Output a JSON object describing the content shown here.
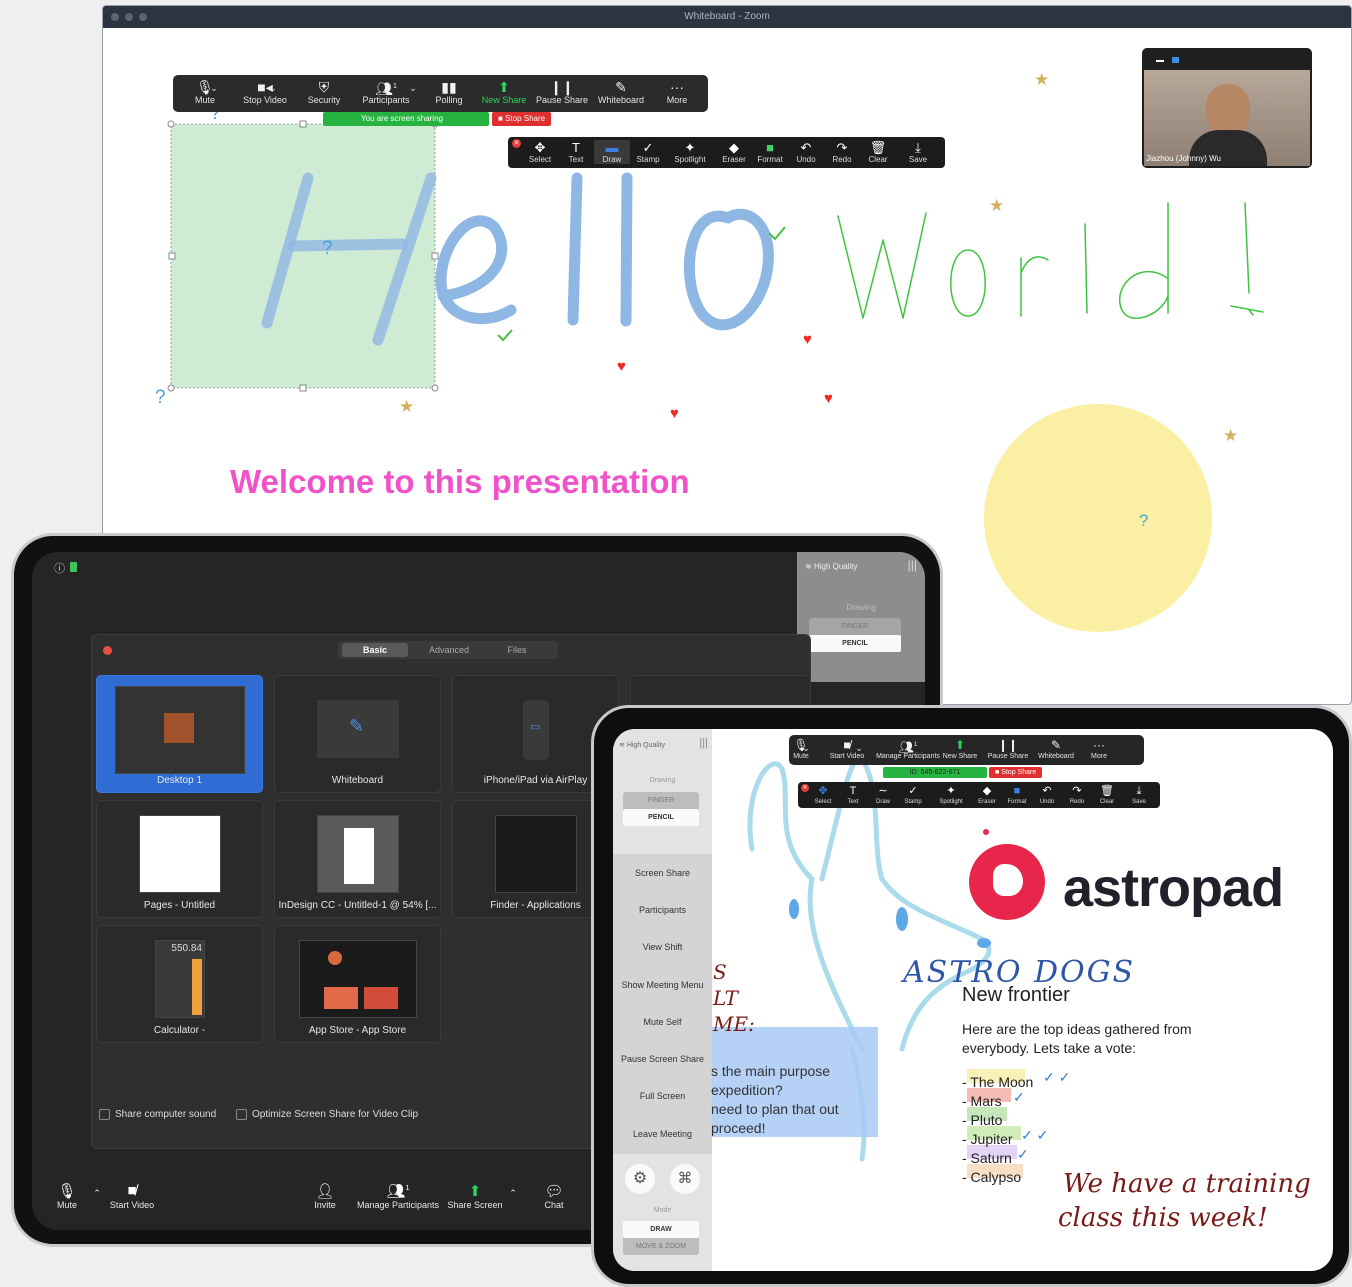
{
  "mac_window": {
    "title": "Whiteboard - Zoom",
    "toolbar": {
      "mute": "Mute",
      "stop_video": "Stop Video",
      "security": "Security",
      "participants": "Participants",
      "participants_count": "1",
      "polling": "Polling",
      "new_share": "New Share",
      "pause_share": "Pause Share",
      "whiteboard": "Whiteboard",
      "more": "More"
    },
    "share_status": "You are screen sharing",
    "stop_share": "Stop Share",
    "annotate_bar": {
      "select": "Select",
      "text": "Text",
      "draw": "Draw",
      "stamp": "Stamp",
      "spotlight": "Spotlight",
      "eraser": "Eraser",
      "format": "Format",
      "undo": "Undo",
      "redo": "Redo",
      "clear": "Clear",
      "save": "Save"
    },
    "video_tile_name": "Jiazhou (Johnny) Wu",
    "canvas_heading": "Welcome to this presentation",
    "colors": {
      "heading": "#ef52c9",
      "hello_stroke": "#8fb7e3",
      "world_stroke": "#3fc43f",
      "sun": "#fbefa3"
    }
  },
  "ipad_share": {
    "status_left": "ⓘ",
    "quality": "High Quality",
    "drawing_label": "Drawing",
    "drawing_options": [
      "FINGER",
      "PENCIL"
    ],
    "tabs": [
      "Basic",
      "Advanced",
      "Files"
    ],
    "active_tab": "Basic",
    "sources": [
      {
        "label": "Desktop 1"
      },
      {
        "label": "Whiteboard"
      },
      {
        "label": "iPhone/iPad via AirPlay"
      },
      {
        "label": "Pages - Untitled"
      },
      {
        "label": "InDesign CC - Untitled-1 @ 54% [..."
      },
      {
        "label": "Finder - Applications"
      },
      {
        "label": "Calculator -"
      },
      {
        "label": "App Store - App Store"
      }
    ],
    "calculator_display": "550.84",
    "options": [
      "Share computer sound",
      "Optimize Screen Share for Video Clip"
    ],
    "controls": {
      "mute": "Mute",
      "start_video": "Start Video",
      "invite": "Invite",
      "manage_participants": "Manage Participants",
      "participants_count": "1",
      "share_screen": "Share Screen",
      "chat": "Chat"
    }
  },
  "ipad_astropad": {
    "quality": "High Quality",
    "drawing_label": "Drawing",
    "drawing_options": [
      "FINGER",
      "PENCIL"
    ],
    "menu": [
      "Screen Share",
      "Participants",
      "View Shift",
      "Show Meeting Menu",
      "Mute Self",
      "Pause Screen Share",
      "Full Screen",
      "Leave Meeting"
    ],
    "mode_label": "Mode",
    "mode_options": [
      "DRAW",
      "MOVE & ZOOM"
    ],
    "toolbar": {
      "mute": "Mute",
      "start_video": "Start Video",
      "manage_participants": "Manage Participants",
      "participants_count": "1",
      "new_share": "New Share",
      "pause_share": "Pause Share",
      "whiteboard": "Whiteboard",
      "more": "More",
      "meeting_id": "ID: 545-622-671",
      "stop_share": "Stop Share"
    },
    "annotate_bar": {
      "select": "Select",
      "text": "Text",
      "draw": "Draw",
      "stamp": "Stamp",
      "spotlight": "Spotlight",
      "eraser": "Eraser",
      "format": "Format",
      "undo": "Undo",
      "redo": "Redo",
      "clear": "Clear",
      "save": "Save"
    },
    "brand": "astropad",
    "handwritten_title": "ASTRO DOGS",
    "slide_title": "New frontier",
    "slide_body": "Here are the top ideas gathered from everybody. Lets take a vote:",
    "planets": [
      "- The Moon",
      "- Mars",
      "- Pluto",
      "- Jupiter",
      "- Saturn",
      "- Calypso"
    ],
    "planet_colors": [
      "#f6efa6",
      "#f4a9a3",
      "#b7e0a7",
      "#c4e8a8",
      "#dcc9f3",
      "#f4d7b6"
    ],
    "blue_box_lines": [
      "s the main purpose",
      "expedition?",
      " need to plan that out",
      "proceed!"
    ],
    "handwritten_note_1": "We have a training",
    "handwritten_note_2": "class this week!",
    "red_scribble_lines": [
      "S",
      "LT",
      "ME:"
    ]
  }
}
